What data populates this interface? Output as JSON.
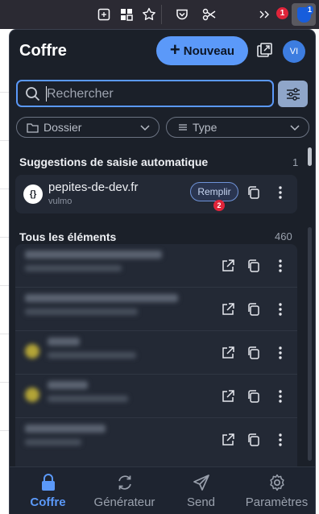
{
  "browser": {
    "extension_badge": "1",
    "bitwarden_count": "1"
  },
  "header": {
    "title": "Coffre",
    "new_button": "Nouveau",
    "avatar_initials": "VI"
  },
  "search": {
    "placeholder": "Rechercher"
  },
  "filters": {
    "folder": "Dossier",
    "type": "Type"
  },
  "autofill": {
    "title": "Suggestions de saisie automatique",
    "count": "1",
    "item": {
      "icon": "{}",
      "name": "pepites-de-dev.fr",
      "username": "vulmo",
      "fill_button": "Remplir",
      "fill_badge": "2"
    }
  },
  "all_items": {
    "title": "Tous les éléments",
    "count": "460"
  },
  "nav": {
    "vault": "Coffre",
    "generator": "Générateur",
    "send": "Send",
    "settings": "Paramètres"
  },
  "colors": {
    "accent": "#5b99f9",
    "popup_bg": "#1b2029",
    "card_bg": "#232935",
    "badge_red": "#e0243a"
  }
}
